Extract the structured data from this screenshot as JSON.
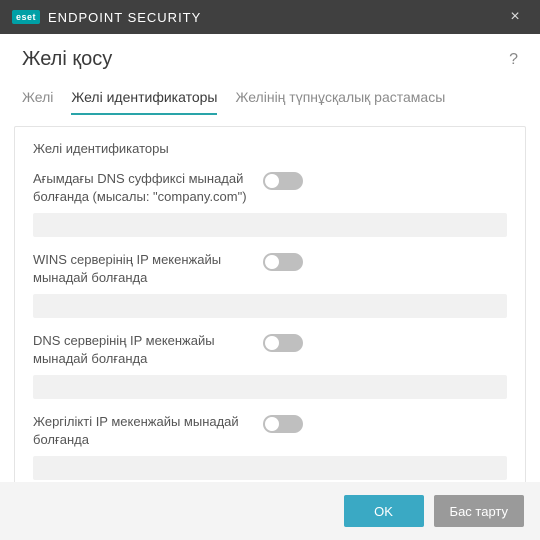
{
  "titlebar": {
    "brand_badge": "eset",
    "brand_text": "ENDPOINT SECURITY"
  },
  "header": {
    "title": "Желі қосу"
  },
  "tabs": [
    {
      "label": "Желі",
      "active": false
    },
    {
      "label": "Желі идентификаторы",
      "active": true
    },
    {
      "label": "Желінің түпнұсқалық растамасы",
      "active": false
    }
  ],
  "section": {
    "title": "Желі идентификаторы"
  },
  "rows": [
    {
      "label": "Ағымдағы DNS суффиксі мынадай болғанда (мысалы: \"company.com\")",
      "enabled": false,
      "value": ""
    },
    {
      "label": "WINS серверінің IP мекенжайы мынадай болғанда",
      "enabled": false,
      "value": ""
    },
    {
      "label": "DNS серверінің IP мекенжайы мынадай болғанда",
      "enabled": false,
      "value": ""
    },
    {
      "label": "Жергілікті IP мекенжайы мынадай болғанда",
      "enabled": false,
      "value": ""
    }
  ],
  "footer": {
    "ok": "OK",
    "cancel": "Бас тарту"
  }
}
